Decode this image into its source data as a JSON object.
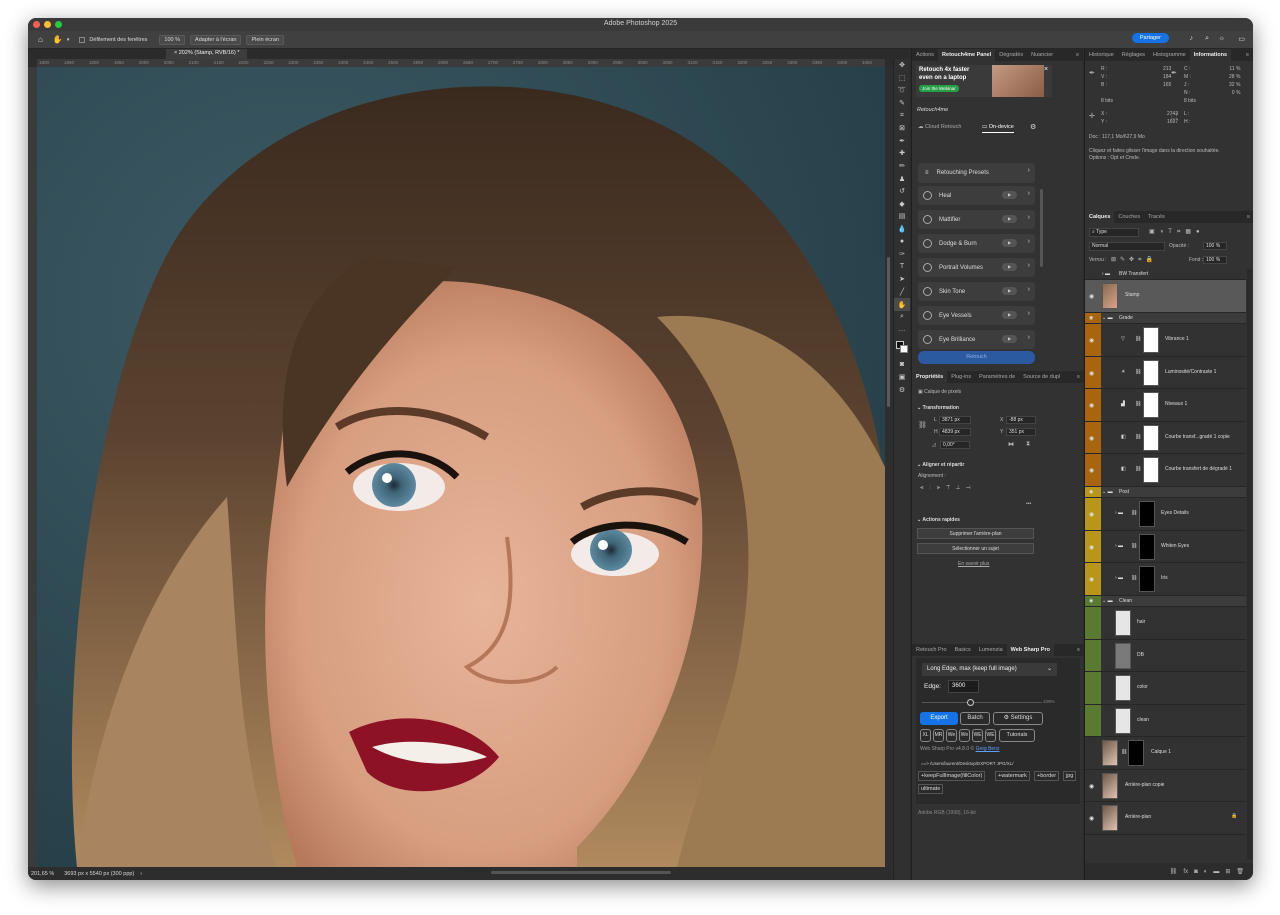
{
  "window": {
    "title": "Adobe Photoshop 2025"
  },
  "options_bar": {
    "scroll_all_windows": "Défilement des fenêtres",
    "zoom_100": "100 %",
    "fit_screen": "Adapter à l'écran",
    "full_screen": "Plein écran",
    "share": "Partager"
  },
  "document": {
    "tab_title": "202% (Stamp, RVB/16) *"
  },
  "rulers": {
    "top_ticks": [
      "1800",
      "1850",
      "1900",
      "1950",
      "2000",
      "2050",
      "2100",
      "2150",
      "2200",
      "2250",
      "2300",
      "2350",
      "2400",
      "2450",
      "2500",
      "2550",
      "2600",
      "2650",
      "2700",
      "2750",
      "2800",
      "2850",
      "2900",
      "2950",
      "3000",
      "3050",
      "3100",
      "3150",
      "3200",
      "3250",
      "3300",
      "3350",
      "3400",
      "3450"
    ]
  },
  "status": {
    "zoom": "201,65 %",
    "doc_info": "3693 px x 5540 px (300 ppp)"
  },
  "panel_tabs_a": [
    "Actions",
    "Retouch4me Panel",
    "Dégradés",
    "Nuancier"
  ],
  "retouch": {
    "ad_line1": "Retouch 4x faster",
    "ad_line2": "even on a laptop",
    "ad_button": "Join the Webinar",
    "logo": "Retouch4me",
    "cloud_tab": "Cloud Retouch",
    "device_tab": "On-device",
    "presets": "Retouching Presets",
    "items": [
      "Heal",
      "Mattifier",
      "Dodge & Burn",
      "Portrait Volumes",
      "Skin Tone",
      "Eye Vessels",
      "Eye Brilliance"
    ],
    "retouch_button": "Retouch"
  },
  "props_tabs": [
    "Propriétés",
    "Plug-ins",
    "Paramètres de",
    "Source de dupl"
  ],
  "properties": {
    "kind": "Calque de pixels",
    "transformation": "Transformation",
    "w_label": "L",
    "w_value": "3871 px",
    "h_label": "H",
    "h_value": "4839 px",
    "x_label": "X",
    "x_value": "-88 px",
    "y_label": "Y",
    "y_value": "351 px",
    "angle": "0,00°",
    "align_title": "Aligner et répartir",
    "align_sub": "Alignement :",
    "quick_title": "Actions rapides",
    "remove_bg": "Supprimer l'arrière-plan",
    "select_subject": "Sélectionner un sujet",
    "learn_more": "En savoir plus"
  },
  "web_tabs": [
    "Retouch Pro",
    "Basics",
    "Lumenzia",
    "Web Sharp Pro"
  ],
  "websharp": {
    "mode": "Long Edge, max (keep full image)",
    "edge_label": "Edge:",
    "edge_value": "3600",
    "slider_pct": "100%",
    "slider_fraction": 0.4,
    "export": "Export",
    "batch": "Batch",
    "settings": "Settings",
    "small_buttons": [
      "XL",
      "MR",
      "We",
      "We",
      "WE",
      "WE"
    ],
    "tutorials": "Tutorials",
    "version": "Web Sharp Pro v4.8.0 ©",
    "author": "Greg Benz",
    "path": "==> /Users/laurent/Desktop/EXPORT JPG/XL/",
    "tags": [
      "+keepFullImage(fillColor)",
      "+watermark",
      "+border",
      "jpg",
      "ultimate"
    ],
    "profile": "Adobe RGB (1998), 16-bit"
  },
  "info_tabs": [
    "Historique",
    "Réglages",
    "Histogramme",
    "Informations"
  ],
  "info": {
    "r_label": "R :",
    "r_value": "213",
    "g_label": "V :",
    "g_value": "184",
    "b_label": "B :",
    "b_value": "165",
    "c_label": "C :",
    "c_value": "11 %",
    "m_label": "M :",
    "m_value": "28 %",
    "y_label": "J :",
    "y_value": "32 %",
    "k_label": "N :",
    "k_value": "0 %",
    "bits1": "8 bits",
    "bits2": "8 bits",
    "x_label": "X :",
    "x_value": "2743",
    "y2_label": "Y :",
    "y2_value": "1697",
    "w_label": "L :",
    "h_label": "H :",
    "doc": "Doc : 117,1 Mo/627,9 Mo",
    "hint1": "Cliquez et faites glisser l'image dans la direction souhaitée.",
    "hint2": "Options : Opt et Cmde."
  },
  "layers_tabs": [
    "Calques",
    "Couches",
    "Tracés"
  ],
  "layers_controls": {
    "type": "Type",
    "blend": "Normal",
    "opacity_label": "Opacité :",
    "opacity": "100 %",
    "lock_label": "Verrou :",
    "fill_label": "Fond :",
    "fill": "100 %"
  },
  "layers": {
    "bw": "BW Transfert",
    "stamp": "Stamp",
    "grade": "Grade",
    "vibrance": "Vibrance 1",
    "luminosity": "Luminosité/Contraste 1",
    "levels": "Niveaux 1",
    "curve_copy": "Courbe transf...gradé 1 copie",
    "curve": "Courbe transfert de dégradé 1",
    "post": "Post",
    "eyes_details": "Eyes Details",
    "whiten_eyes": "Whiten Eyes",
    "iris": "Iris",
    "clean_group": "Clean",
    "hair": "hair",
    "db": "DB",
    "color": "color",
    "clean": "clean",
    "calque1": "Calque 1",
    "bg_copy": "Arrière-plan copie",
    "bg": "Arrière-plan"
  },
  "colors": {
    "accent": "#1473e6",
    "grade": "#a8650e",
    "post": "#b8961a",
    "clean": "#5a7a32"
  }
}
